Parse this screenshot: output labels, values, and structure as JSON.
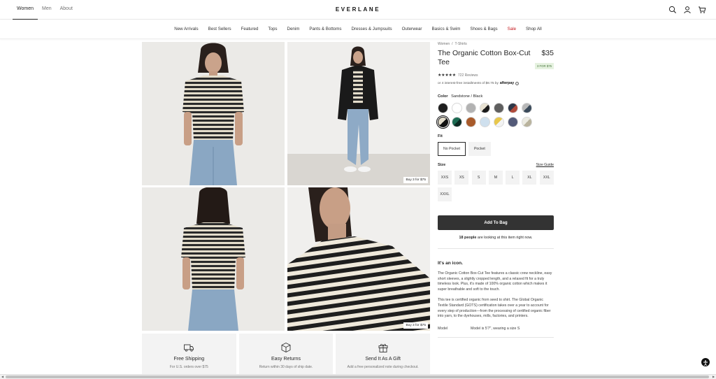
{
  "header": {
    "tabs": [
      "Women",
      "Men",
      "About"
    ],
    "logo": "EVERLANE",
    "icons": [
      "search-icon",
      "account-icon",
      "cart-icon"
    ]
  },
  "nav": {
    "items": [
      "New Arrivals",
      "Best Sellers",
      "Featured",
      "Tops",
      "Denim",
      "Pants & Bottoms",
      "Dresses & Jumpsuits",
      "Outerwear",
      "Basics & Swim",
      "Shoes & Bags",
      "Sale",
      "Shop All"
    ],
    "sale_color": "#c3141a"
  },
  "gallery": {
    "promo_tag": "Buy 3 for $75"
  },
  "features": [
    {
      "icon": "truck-icon",
      "title": "Free Shipping",
      "subtitle": "For U.S. orders over $75"
    },
    {
      "icon": "box-icon",
      "title": "Easy Returns",
      "subtitle": "Return within 30 days of ship date."
    },
    {
      "icon": "gift-icon",
      "title": "Send It As A Gift",
      "subtitle": "Add a free personalized note during checkout."
    }
  ],
  "product": {
    "breadcrumb": [
      "Women",
      "/",
      "T-Shirts"
    ],
    "title": "The Organic Cotton Box-Cut Tee",
    "price": "$35",
    "deal": "3 FOR $75",
    "stars": "★★★★★",
    "rating": 4.5,
    "reviews": "722 Reviews",
    "afterpay_text": "or 4 interest-free installments of $8.75 by",
    "afterpay_brand": "afterpay",
    "color_label": "Color",
    "color_value": "Sandstone / Black",
    "swatch_colors": [
      "#1f1f1f",
      "#ffffff",
      "#b2b2b2",
      "#e8e2d2|#1a1a1a",
      "#5f5f5f",
      "#2e3748|#b04a3a",
      "#b8b8b8|#3a4a5a",
      "#e2dccb|#111111",
      "#1c6b52|#0d2b24",
      "#a85a2a",
      "#cfe0ee",
      "#e8c74a|#f3f3f3",
      "#535a78",
      "#ecebe2|#b9b39d"
    ],
    "selected_swatch": 7,
    "fit_label": "Fit",
    "fit_options": [
      "No Pocket",
      "Pocket"
    ],
    "size_label": "Size",
    "size_guide": "Size Guide",
    "sizes": [
      "XXS",
      "XS",
      "S",
      "M",
      "L",
      "XL",
      "XXL",
      "XXXL"
    ],
    "add_to_bag": "Add To Bag",
    "viewers_count": "18 people",
    "viewers_text": "are looking at this item right now.",
    "icon_heading": "It's an icon.",
    "description_1": "The Organic Cotton Box-Cut Tee features a classic crew neckline, easy short sleeves, a slightly cropped length, and a relaxed fit for a truly timeless look. Plus, it's made of 100% organic cotton which makes it super breathable and soft to the touch.",
    "description_2": "This tee is certified organic from seed to shirt. The Global Organic Textile Standard (GOTS) certification takes over a year to account for every step of production—from the processing of certified organic fiber into yarn, to the dyehouses, mills, factories, and printers.",
    "model_label": "Model",
    "model_value": "Model is 5'7\", wearing a size S"
  }
}
